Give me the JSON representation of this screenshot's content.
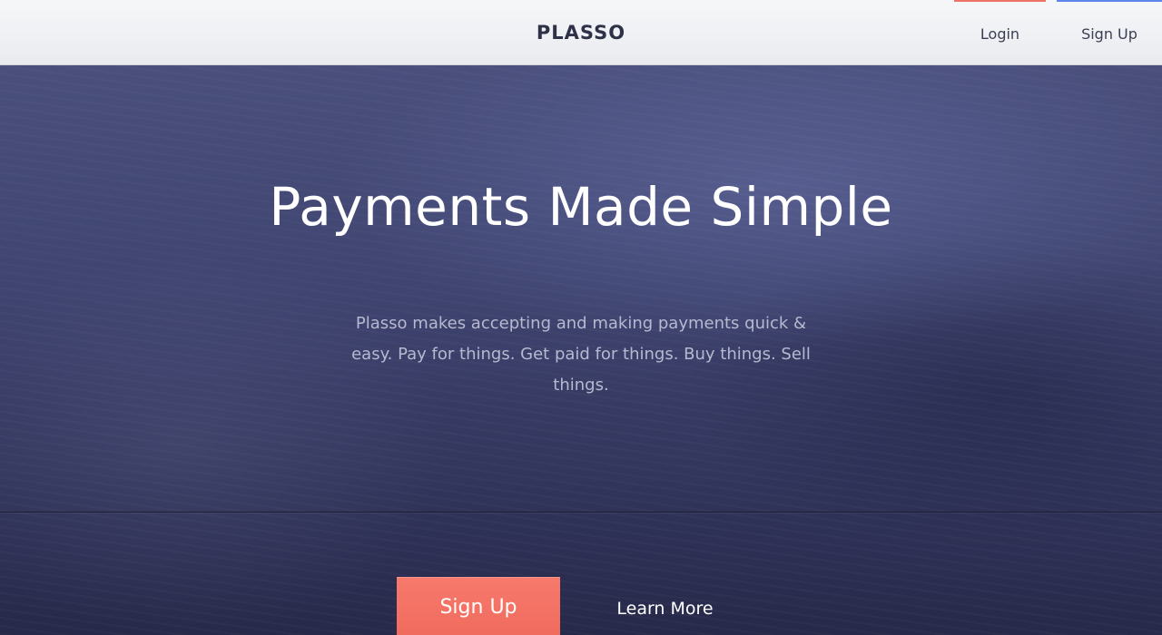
{
  "header": {
    "logo_text": "PLASSO",
    "nav": {
      "login_label": "Login",
      "signup_label": "Sign Up"
    }
  },
  "hero": {
    "headline": "Payments Made Simple",
    "subtext": "Plasso makes accepting and making payments quick & easy. Pay for things. Get paid for things. Buy things. Sell things.",
    "cta": {
      "signup_label": "Sign Up",
      "learn_more_label": "Learn More"
    }
  },
  "colors": {
    "accent_login": "#f0736a",
    "accent_signup": "#5f86ec",
    "cta_signup_bg": "#f27264",
    "hero_bg": "#3f4470"
  }
}
